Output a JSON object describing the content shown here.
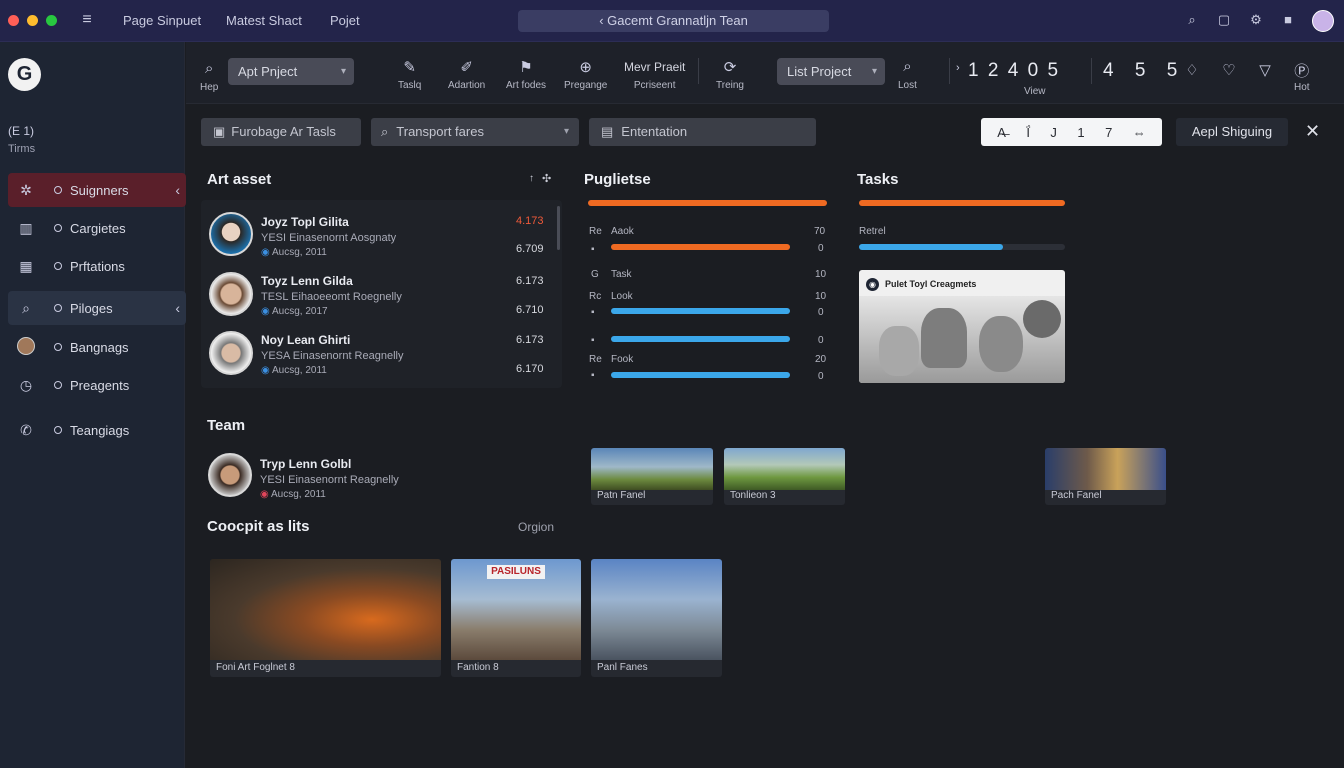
{
  "titlebar": {
    "menu": [
      "Page Sinpuet",
      "Matest Shact",
      "Pojet"
    ],
    "search": "‹  Gacemt Grannatljn Tean",
    "colors": {
      "close": "#ff5f57",
      "min": "#febc2e",
      "max": "#28c840"
    }
  },
  "sidebar": {
    "logo": "G",
    "header": "(E 1)",
    "header_sub": "Tirms",
    "items": [
      {
        "label": "Suignners",
        "icon": "network-icon",
        "active": true
      },
      {
        "label": "Cargietes",
        "icon": "building-icon"
      },
      {
        "label": "Prftations",
        "icon": "grid-building-icon"
      },
      {
        "label": "Piloges",
        "icon": "search-icon",
        "active": true
      },
      {
        "label": "Bangnags",
        "icon": "avatar-icon"
      },
      {
        "label": "Preagents",
        "icon": "clock-icon"
      },
      {
        "label": "Teangiags",
        "icon": "phone-icon"
      }
    ]
  },
  "toolbar": {
    "search_label": "Hep",
    "project_select": "Apt Pnject",
    "tools": [
      {
        "label": "Taslq",
        "icon": "brush-icon"
      },
      {
        "label": "Adartion",
        "icon": "pen-icon"
      },
      {
        "label": "Art fodes",
        "icon": "flag-icon"
      },
      {
        "label": "Pregange",
        "icon": "globe-icon"
      },
      {
        "label": "Pcriseent",
        "top": "Mevr Praeit"
      },
      {
        "label": "Treing",
        "icon": "refresh-icon"
      }
    ],
    "list_select": "List Project",
    "lost_label": "Lost",
    "numbers": [
      "1",
      "2",
      "4",
      "0",
      "5",
      "5",
      "4",
      "5",
      "5"
    ],
    "numbers_prefix": "›",
    "view_label": "View",
    "hot_label": "Hot"
  },
  "filters": {
    "f1": "Furobage Ar Tasls",
    "f2": "Transport fares",
    "f3": "Ententation",
    "format_tools": [
      "A̶",
      "Ḯ",
      "J",
      "1",
      "7",
      "⇔"
    ],
    "apply": "Aepl Shiguing"
  },
  "art_asset": {
    "title": "Art asset",
    "people": [
      {
        "name": "Joyz Topl Gilita",
        "sub": "YESI Einasenornt Aosgnaty",
        "date": "Aucsg, 2011",
        "v1": "4.173",
        "v2": "6.709",
        "v1_red": true
      },
      {
        "name": "Toyz Lenn Gilda",
        "sub": "TESL Eihaoeeomt Roegnelly",
        "date": "Aucsg, 2017",
        "v1": "6.173",
        "v2": "6.710"
      },
      {
        "name": "Noy Lean Ghirti",
        "sub": "YESA Einasenornt Reagnelly",
        "date": "Aucsg, 2011",
        "v1": "6.173",
        "v2": "6.170"
      }
    ]
  },
  "progress": {
    "title": "Puglietse",
    "rows": [
      {
        "a": "Re",
        "b": "Aaok",
        "value": "70",
        "fill": 0.93,
        "color": "#ef6a22"
      },
      {
        "a": "",
        "b": "",
        "value": "0",
        "fill": 1.0,
        "color": "#ef6a22"
      },
      {
        "a": "G",
        "b": "Task",
        "value": "10",
        "fill": 0,
        "color": "#3ba7ea"
      },
      {
        "a": "Rc",
        "b": "Look",
        "value": "10",
        "fill": 0,
        "color": "#3ba7ea"
      },
      {
        "a": "",
        "b": "",
        "value": "0",
        "fill": 1.0,
        "color": "#3ba7ea"
      },
      {
        "a": "",
        "b": "",
        "value": "0",
        "fill": 1.0,
        "color": "#3ba7ea"
      },
      {
        "a": "Re",
        "b": "Fook",
        "value": "20",
        "fill": 0,
        "color": "#3ba7ea"
      },
      {
        "a": "",
        "b": "",
        "value": "0",
        "fill": 1.0,
        "color": "#3ba7ea"
      }
    ]
  },
  "tasks": {
    "title": "Tasks",
    "label": "Retrel",
    "bar1": 1.0,
    "bar2": 0.7,
    "card_title": "Pulet Toyl Creagmets"
  },
  "team": {
    "title": "Team",
    "person": {
      "name": "Tryp Lenn Golbl",
      "sub": "YESI Einasenornt Reagnelly",
      "date": "Aucsg, 2011"
    },
    "thumbs": [
      {
        "caption": "Patn Fanel"
      },
      {
        "caption": "Tonlieon 3"
      },
      {
        "caption": "Pach Fanel"
      }
    ]
  },
  "concept": {
    "title": "Coocpit as lits",
    "right": "Orgion",
    "cards": [
      {
        "caption": "Foni Art Foglnet 8"
      },
      {
        "caption": "Fantion 8",
        "badge": "PASILUNS"
      },
      {
        "caption": "Panl Fanes"
      }
    ]
  }
}
